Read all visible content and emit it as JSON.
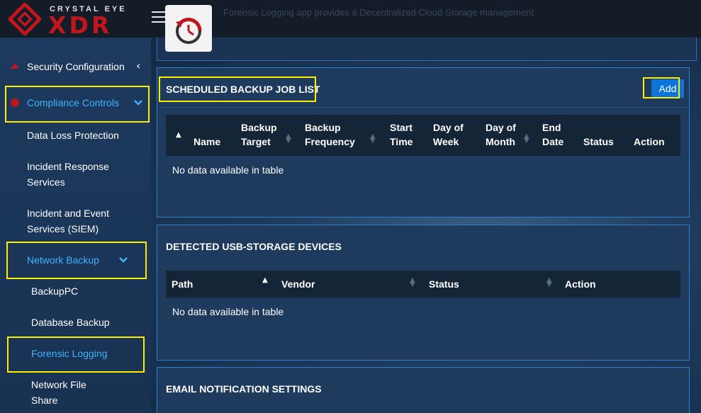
{
  "brand": {
    "small": "CRYSTAL EYE",
    "big": "XDR",
    "accent": "#c1161d"
  },
  "app": {
    "description": "Forensic Logging app provides a Decentralized Cloud Storage management"
  },
  "sidebar": {
    "items": [
      {
        "label": "Security Configuration",
        "icon": "triangle-up-icon"
      },
      {
        "label": "Compliance Controls",
        "icon": "circle-icon"
      },
      {
        "label": "Data Loss Protection"
      },
      {
        "label_line1": "Incident Response",
        "label_line2": "Services"
      },
      {
        "label_line1": "Incident and Event",
        "label_line2": "Services (SIEM)"
      },
      {
        "label": "Network Backup"
      },
      {
        "label": "BackupPC"
      },
      {
        "label": "Database Backup"
      },
      {
        "label": "Forensic Logging"
      },
      {
        "label_line1": "Network File",
        "label_line2": "Share"
      }
    ]
  },
  "backup_panel": {
    "title": "SCHEDULED BACKUP JOB LIST",
    "add_label": "Add",
    "columns": [
      {
        "line1": "Name",
        "line2": ""
      },
      {
        "line1": "Backup",
        "line2": "Target"
      },
      {
        "line1": "Backup",
        "line2": "Frequency"
      },
      {
        "line1": "Start",
        "line2": "Time"
      },
      {
        "line1": "Day of",
        "line2": "Week"
      },
      {
        "line1": "Day of",
        "line2": "Month"
      },
      {
        "line1": "End",
        "line2": "Date"
      },
      {
        "line1": "Status",
        "line2": ""
      },
      {
        "line1": "Action",
        "line2": ""
      }
    ],
    "empty": "No data available in table"
  },
  "usb_panel": {
    "title": "DETECTED USB-STORAGE DEVICES",
    "columns": [
      "Path",
      "Vendor",
      "Status",
      "Action"
    ],
    "empty": "No data available in table"
  },
  "email_panel": {
    "title": "EMAIL NOTIFICATION SETTINGS"
  },
  "colors": {
    "active": "#3fb3ff",
    "highlight": "#ffed00",
    "button": "#0d74d9"
  }
}
